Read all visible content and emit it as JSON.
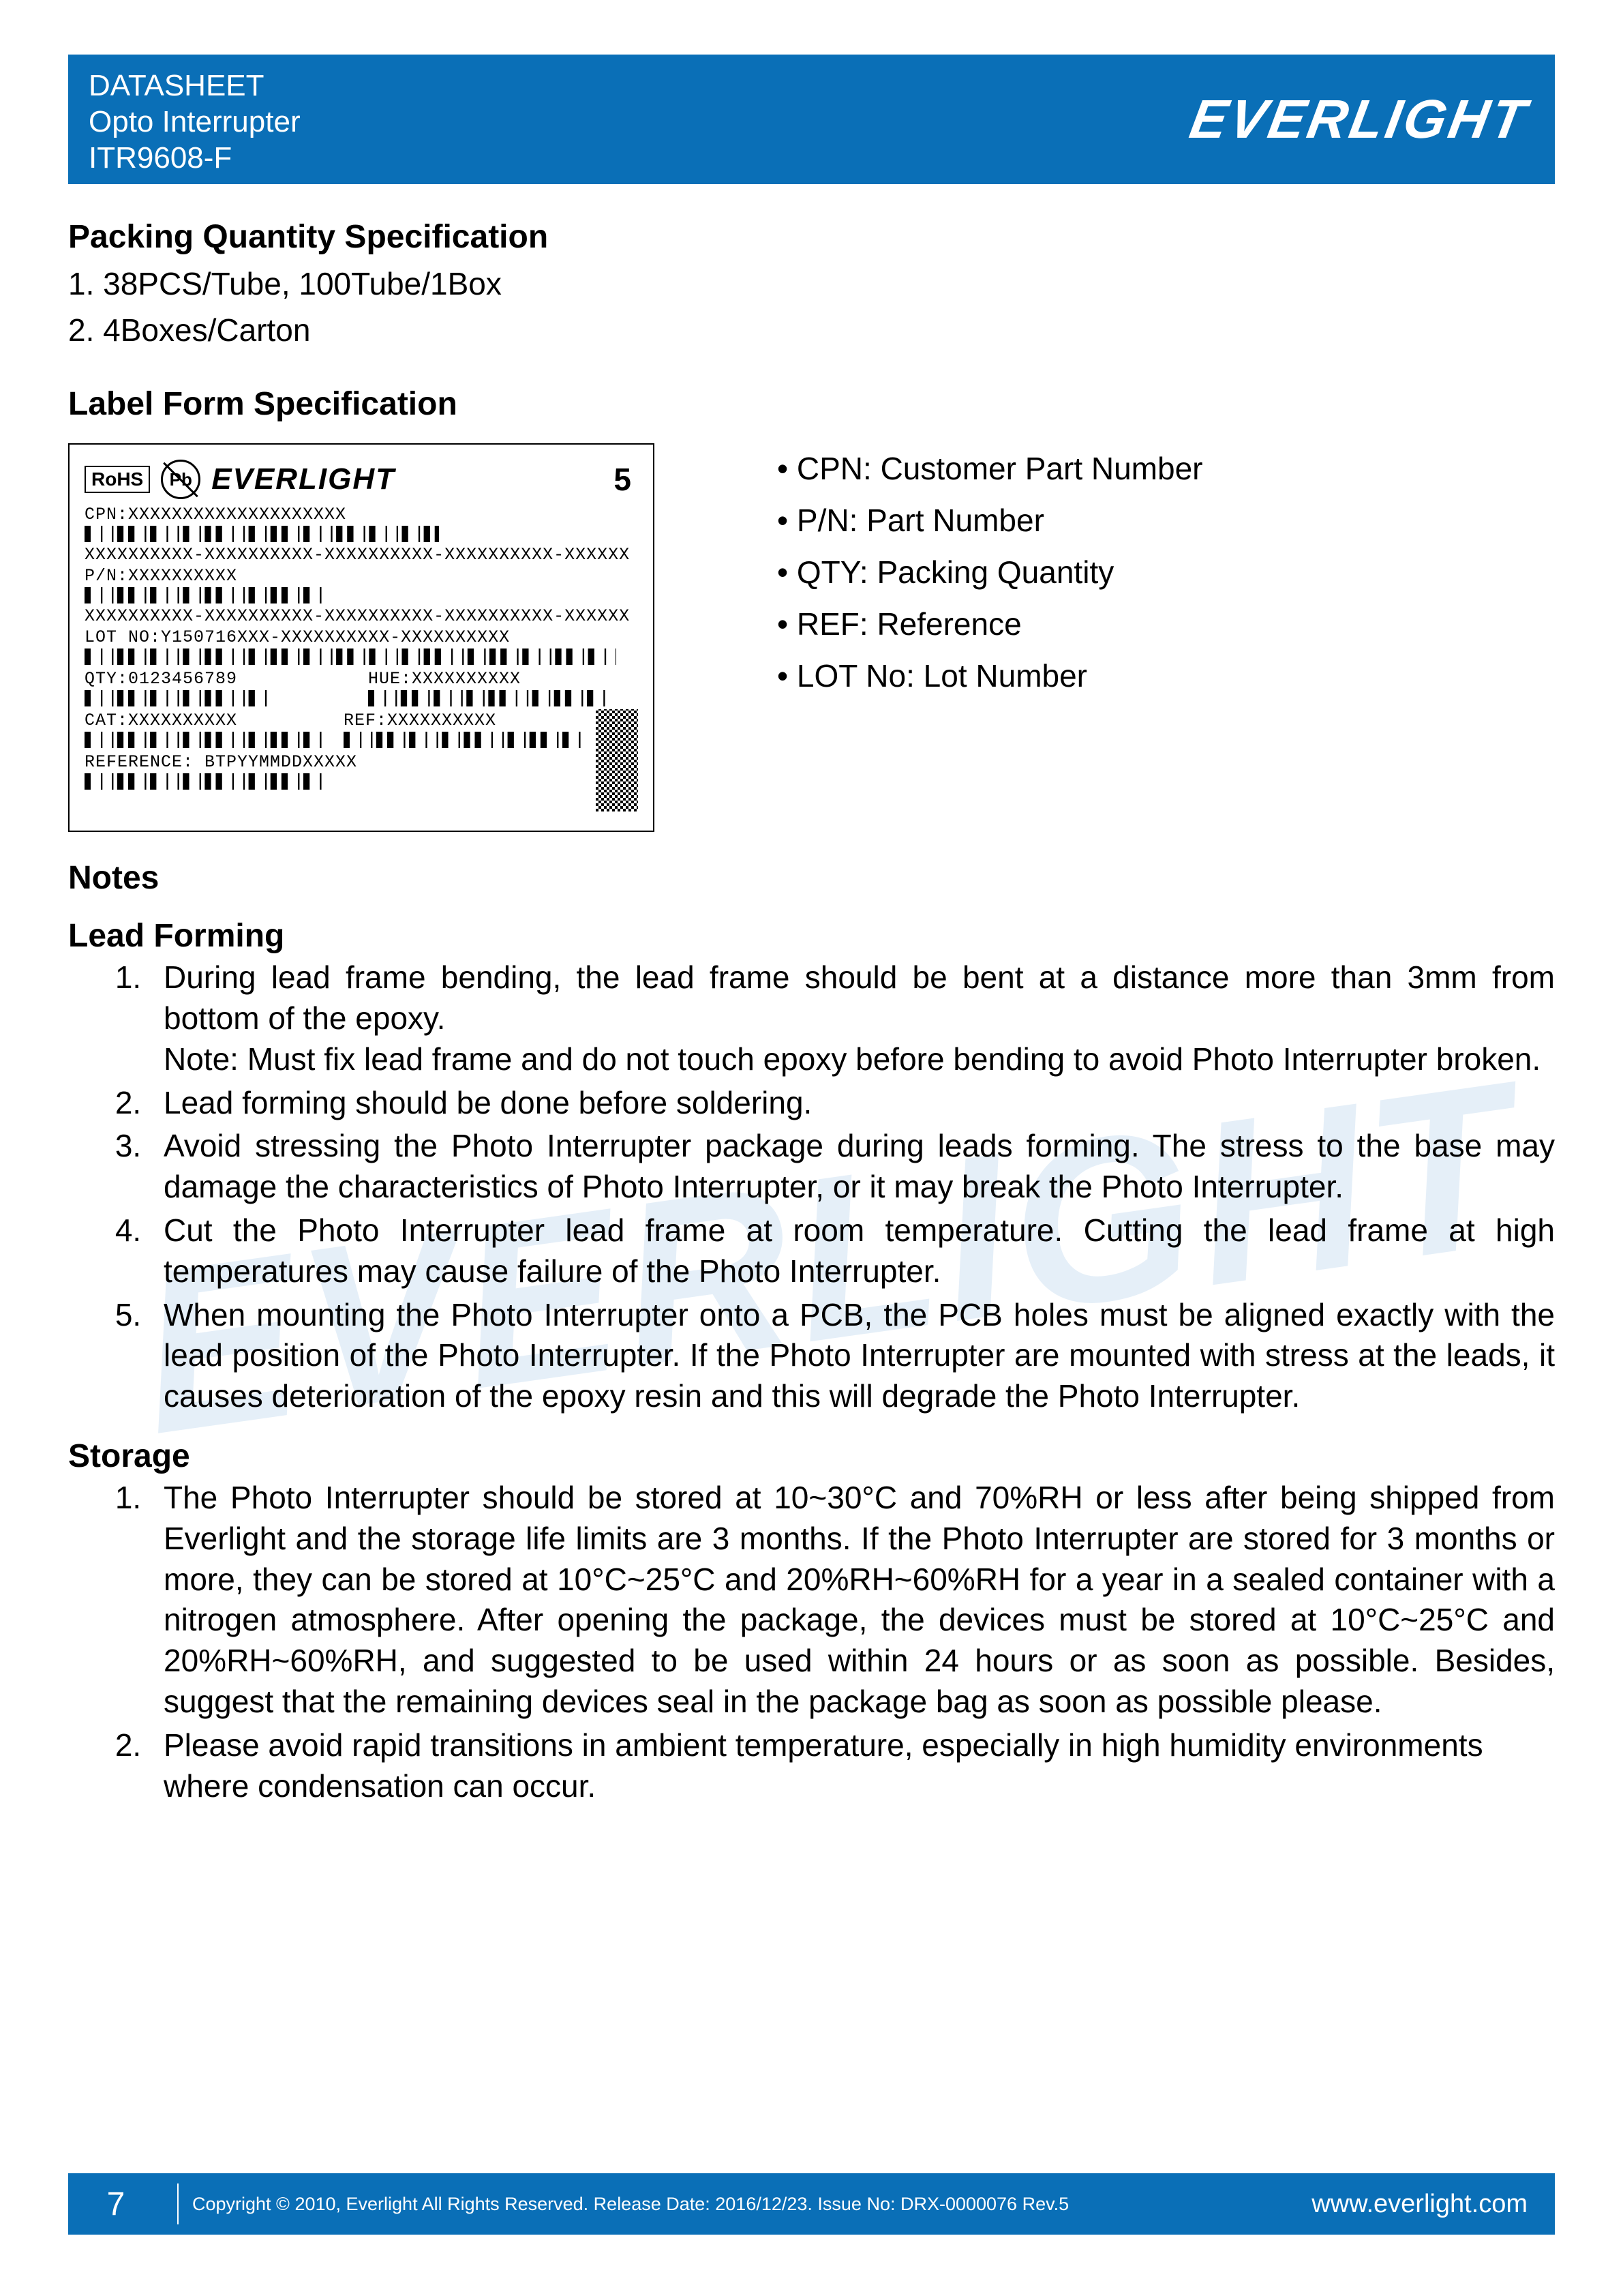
{
  "header": {
    "line1": "DATASHEET",
    "line2": "Opto Interrupter",
    "line3": "ITR9608-F",
    "brand": "EVERLIGHT"
  },
  "packing": {
    "title": "Packing Quantity Specification",
    "items": [
      "1. 38PCS/Tube, 100Tube/1Box",
      "2. 4Boxes/Carton"
    ]
  },
  "labelform": {
    "title": "Label Form Specification",
    "rohs": "RoHS",
    "pb": "Pb",
    "brand": "EVERLIGHT",
    "five": "5",
    "cpn": "CPN:XXXXXXXXXXXXXXXXXXXX",
    "xrow": "XXXXXXXXXX-XXXXXXXXXX-XXXXXXXXXX-XXXXXXXXXX-XXXXXX",
    "pn": "P/N:XXXXXXXXXX",
    "lot": "LOT NO:Y150716XXX-XXXXXXXXXX-XXXXXXXXXX",
    "qty": "QTY:0123456789",
    "hue": "HUE:XXXXXXXXXX",
    "cat": "CAT:XXXXXXXXXX",
    "ref": "REF:XXXXXXXXXX",
    "reference": "REFERENCE: BTPYYMMDDXXXXX"
  },
  "legend": {
    "items": [
      "CPN: Customer Part Number",
      "P/N: Part Number",
      "QTY: Packing Quantity",
      "REF: Reference",
      "LOT No: Lot Number"
    ]
  },
  "notes": {
    "title": "Notes",
    "lead_title": "Lead Forming",
    "lead_items": [
      "During lead frame bending, the lead frame should be bent at a distance more than 3mm from bottom of the epoxy.\nNote: Must fix lead frame and do not touch epoxy before bending to avoid Photo Interrupter broken.",
      "Lead forming should be done before soldering.",
      "Avoid stressing the Photo Interrupter package during leads forming. The stress to the base may damage the characteristics of Photo Interrupter, or it may break the Photo Interrupter.",
      "Cut the Photo Interrupter lead frame at room temperature. Cutting the lead frame at high temperatures may cause failure of the Photo Interrupter.",
      "When mounting the Photo Interrupter onto a PCB, the PCB holes must be aligned exactly with the lead position of the Photo Interrupter. If the Photo Interrupter are mounted with stress at the leads, it causes deterioration of the epoxy resin and this will degrade the Photo Interrupter."
    ],
    "storage_title": "Storage",
    "storage_items": [
      "The Photo Interrupter should be stored at 10~30°C and 70%RH or less after being shipped from Everlight and the storage life limits are 3 months. If the Photo Interrupter are stored for 3 months or more, they can be stored at 10°C~25°C and 20%RH~60%RH for a year in a sealed container with a nitrogen atmosphere. After opening the package, the devices must be stored at 10°C~25°C and 20%RH~60%RH, and suggested to be used within 24 hours or as soon as possible. Besides, suggest that the remaining devices seal in the package bag as soon as possible please.",
      "Please avoid rapid transitions in ambient temperature, especially in high humidity environments where condensation can occur."
    ]
  },
  "footer": {
    "page": "7",
    "center": "Copyright © 2010, Everlight All Rights Reserved. Release Date: 2016/12/23. Issue No: DRX-0000076 Rev.5",
    "right": "www.everlight.com"
  },
  "watermark": "EVERLIGHT"
}
